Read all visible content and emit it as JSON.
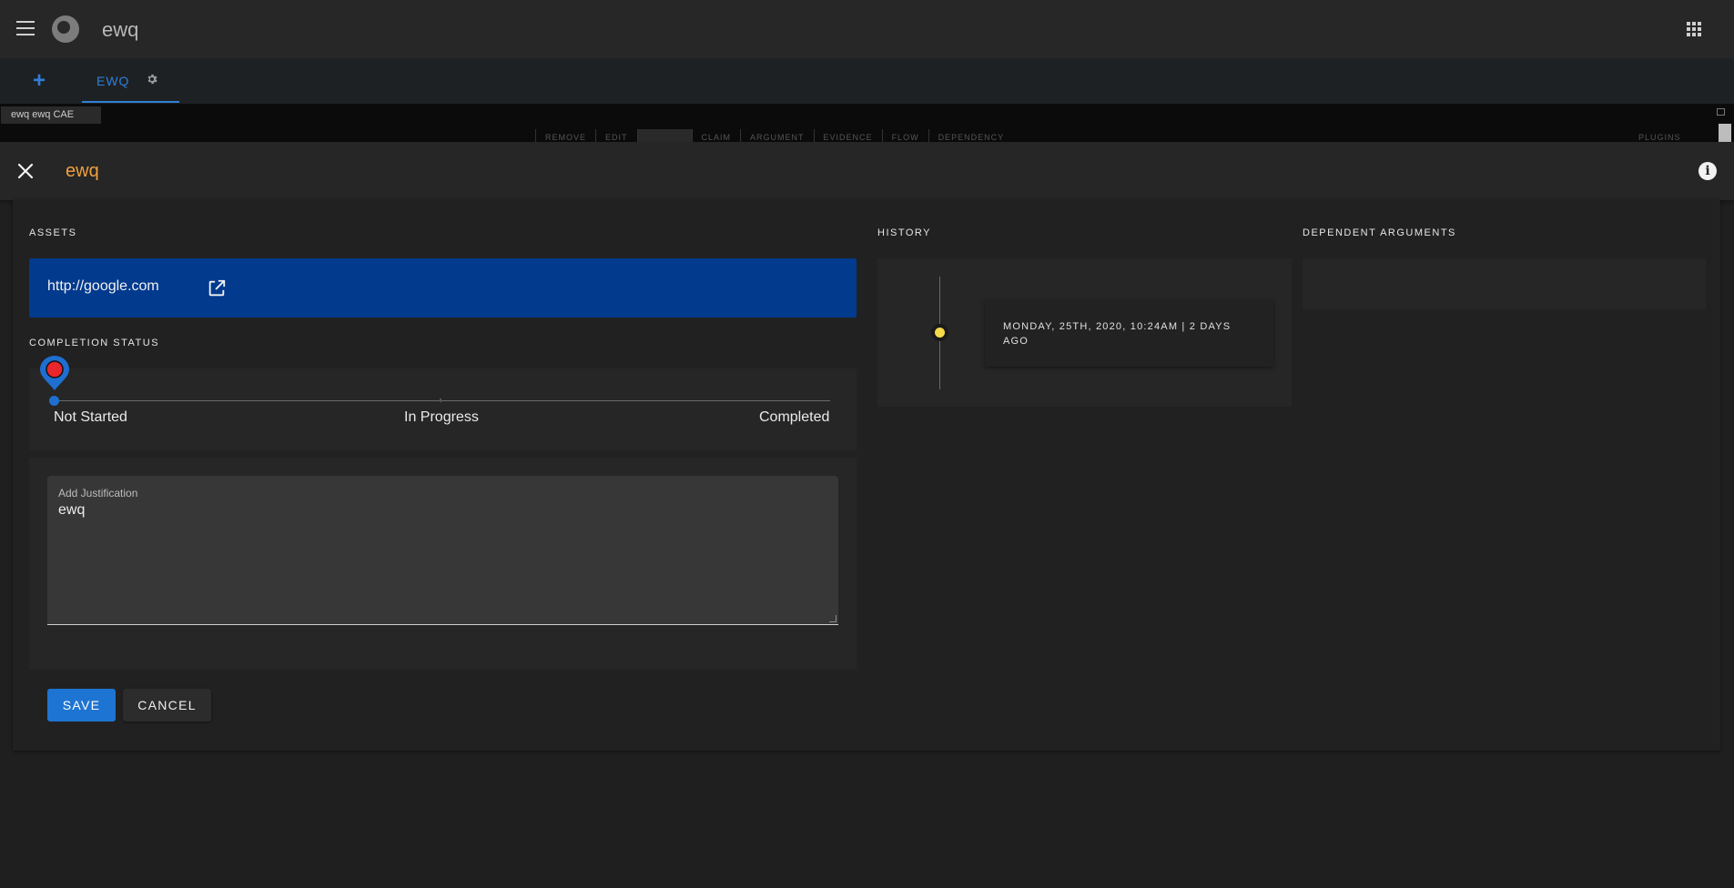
{
  "app": {
    "title": "ewq"
  },
  "tabs": [
    {
      "label": "EWQ"
    }
  ],
  "canvas": {
    "graph_tab": "ewq ewq CAE",
    "toolbar": [
      "REMOVE",
      "EDIT",
      "",
      "CLAIM",
      "ARGUMENT",
      "EVIDENCE",
      "FLOW",
      "DEPENDENCY"
    ],
    "toolbar_right": "PLUGINS"
  },
  "dialog": {
    "title": "ewq",
    "assets": {
      "section_title": "ASSETS",
      "link": "http://google.com"
    },
    "completion": {
      "section_title": "COMPLETION STATUS",
      "stops": [
        "Not Started",
        "In Progress",
        "Completed"
      ],
      "selected_index": 0
    },
    "justification": {
      "label": "Add Justification",
      "value": "ewq"
    },
    "buttons": {
      "save": "SAVE",
      "cancel": "CANCEL"
    },
    "history": {
      "section_title": "HISTORY",
      "entries": [
        {
          "text": "MONDAY, 25TH, 2020, 10:24AM | 2 DAYS AGO"
        }
      ]
    },
    "dependent": {
      "section_title": "DEPENDENT ARGUMENTS"
    }
  },
  "colors": {
    "accent": "#1e74d2",
    "title_orange": "#f0a040",
    "asset_bg": "#023a8e",
    "timeline_dot": "#f5d94a",
    "pin_red": "#e8262b"
  },
  "icons": [
    "menu-icon",
    "logo-icon",
    "apps-grid-icon",
    "add-icon",
    "gear-icon",
    "close-icon",
    "info-icon",
    "open-in-new-icon",
    "map-pin-icon"
  ]
}
